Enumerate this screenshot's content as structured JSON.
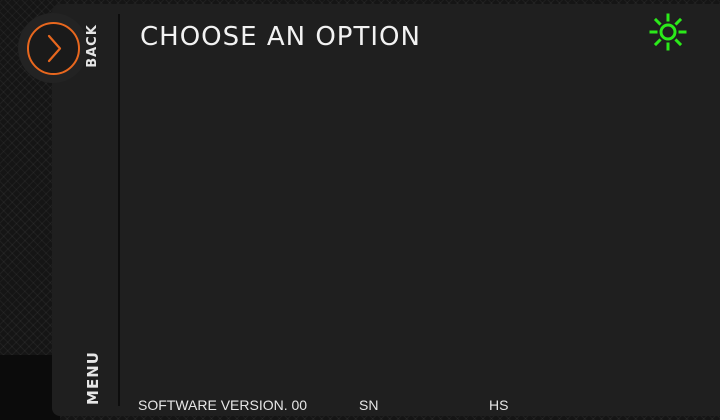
{
  "header": {
    "title": "CHOOSE AN OPTION",
    "back_label": "BACK",
    "brightness_icon": "brightness-icon",
    "brightness_color": "#2bea1a",
    "back_icon": "chevron-right-icon",
    "accent_color": "#e8671e"
  },
  "sidebar": {
    "menu_label": "MENU"
  },
  "footer": {
    "software_version": "SOFTWARE VERSION. 00",
    "sn_label": "SN",
    "hs_label": "HS"
  }
}
